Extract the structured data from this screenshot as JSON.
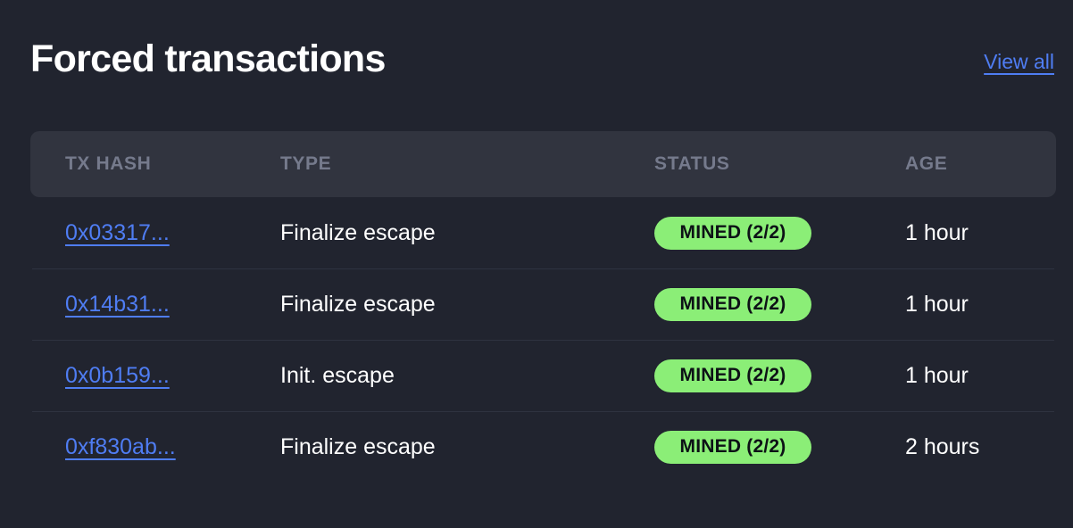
{
  "panel": {
    "title": "Forced transactions",
    "view_all_label": "View all",
    "background_color": "#21242f",
    "link_color": "#4f7df3",
    "badge_color": "#8bee77",
    "header_band_color": "#31343f"
  },
  "table": {
    "columns": [
      {
        "key": "tx_hash",
        "label": "TX HASH"
      },
      {
        "key": "type",
        "label": "TYPE"
      },
      {
        "key": "status",
        "label": "STATUS"
      },
      {
        "key": "age",
        "label": "AGE"
      }
    ],
    "rows": [
      {
        "tx_hash": "0x03317...",
        "type": "Finalize escape",
        "status": "MINED (2/2)",
        "age": "1 hour"
      },
      {
        "tx_hash": "0x14b31...",
        "type": "Finalize escape",
        "status": "MINED (2/2)",
        "age": "1 hour"
      },
      {
        "tx_hash": "0x0b159...",
        "type": "Init. escape",
        "status": "MINED (2/2)",
        "age": "1 hour"
      },
      {
        "tx_hash": "0xf830ab...",
        "type": "Finalize escape",
        "status": "MINED (2/2)",
        "age": "2 hours"
      }
    ]
  }
}
